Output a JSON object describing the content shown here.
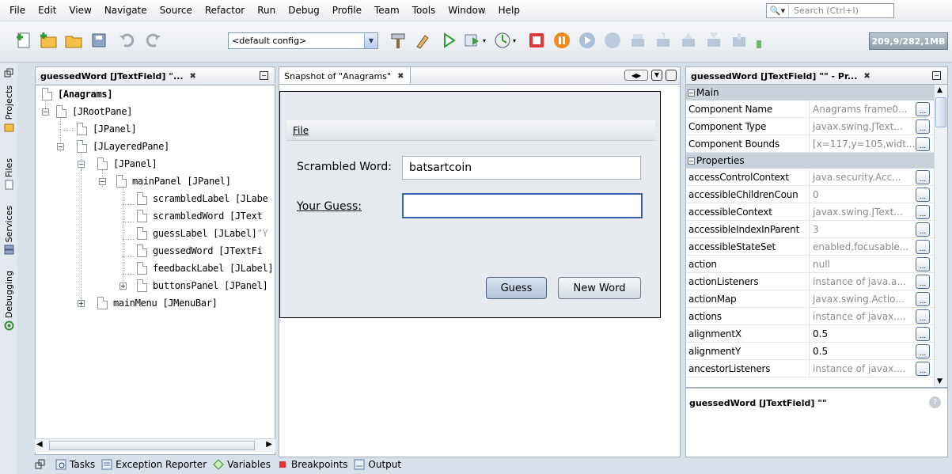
{
  "menubar": {
    "items": [
      "File",
      "Edit",
      "View",
      "Navigate",
      "Source",
      "Refactor",
      "Run",
      "Debug",
      "Profile",
      "Team",
      "Tools",
      "Window",
      "Help"
    ],
    "search_placeholder": "Search (Ctrl+I)"
  },
  "toolbar": {
    "config_value": "<default config>",
    "memory": "209,9/282,1MB"
  },
  "sidebar_tabs": [
    "Projects",
    "Files",
    "Services",
    "Debugging"
  ],
  "navigator": {
    "tab_label": "guessedWord [JTextField] \"...",
    "tree": [
      {
        "label": "[Anagrams]"
      },
      {
        "label": "[JRootPane]"
      },
      {
        "label": "[JPanel]"
      },
      {
        "label": "[JLayeredPane]"
      },
      {
        "label": "[JPanel]"
      },
      {
        "label": "mainPanel [JPanel]"
      },
      {
        "label": "scrambledLabel [JLabe"
      },
      {
        "label": "scrambledWord [JText"
      },
      {
        "label": "guessLabel [JLabel]",
        "extra": " \"Y"
      },
      {
        "label": "guessedWord [JTextFi"
      },
      {
        "label": "feedbackLabel [JLabel]"
      },
      {
        "label": "buttonsPanel [JPanel]"
      },
      {
        "label": "mainMenu [JMenuBar]"
      }
    ]
  },
  "snapshot": {
    "tab_label": "Snapshot of \"Anagrams\"",
    "menu_file": "File",
    "scrambled_label": "Scrambled Word:",
    "scrambled_value": "batsartcoin",
    "guess_label": "Your Guess:",
    "guess_value": "",
    "guess_button": "Guess",
    "new_word_button": "New Word"
  },
  "properties": {
    "tab_label": "guessedWord [JTextField] \"\" - Pr...",
    "categories": {
      "main": "Main",
      "properties": "Properties"
    },
    "main_rows": [
      {
        "name": "Component Name",
        "value": "Anagrams  frame0..."
      },
      {
        "name": "Component Type",
        "value": "javax.swing.JText..."
      },
      {
        "name": "Component Bounds",
        "value": "[x=117,y=105,widt..."
      }
    ],
    "prop_rows": [
      {
        "name": "accessControlContext",
        "value": "java.security.Acc...",
        "dark": false
      },
      {
        "name": "accessibleChildrenCoun",
        "value": "0",
        "dark": false
      },
      {
        "name": "accessibleContext",
        "value": "javax.swing.JText...",
        "dark": false
      },
      {
        "name": "accessibleIndexInParent",
        "value": "3",
        "dark": false
      },
      {
        "name": "accessibleStateSet",
        "value": "enabled,focusable...",
        "dark": false
      },
      {
        "name": "action",
        "value": "null",
        "dark": false
      },
      {
        "name": "actionListeners",
        "value": "instance of java.a...",
        "dark": false
      },
      {
        "name": "actionMap",
        "value": "javax.swing.Actio...",
        "dark": false
      },
      {
        "name": "actions",
        "value": "instance of javax....",
        "dark": false
      },
      {
        "name": "alignmentX",
        "value": "0.5",
        "dark": true
      },
      {
        "name": "alignmentY",
        "value": "0.5",
        "dark": true
      },
      {
        "name": "ancestorListeners",
        "value": "instance of javax....",
        "dark": false
      }
    ],
    "description_title": "guessedWord [JTextField] \"\""
  },
  "bottom_tabs": [
    "Tasks",
    "Exception Reporter",
    "Variables",
    "Breakpoints",
    "Output"
  ]
}
